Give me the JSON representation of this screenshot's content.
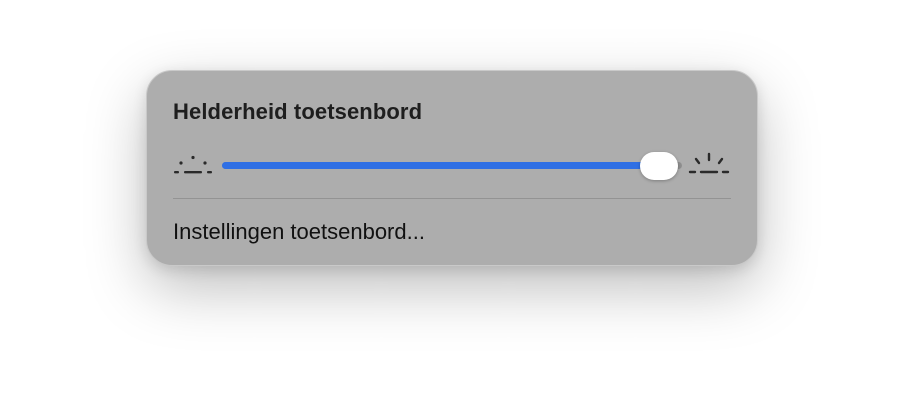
{
  "panel": {
    "title": "Helderheid toetsenbord",
    "slider": {
      "value": 0.95,
      "fill_color": "#2f6fe4",
      "min_icon": "brightness-low-icon",
      "max_icon": "brightness-high-icon"
    },
    "menu_item_label": "Instellingen toetsenbord..."
  }
}
